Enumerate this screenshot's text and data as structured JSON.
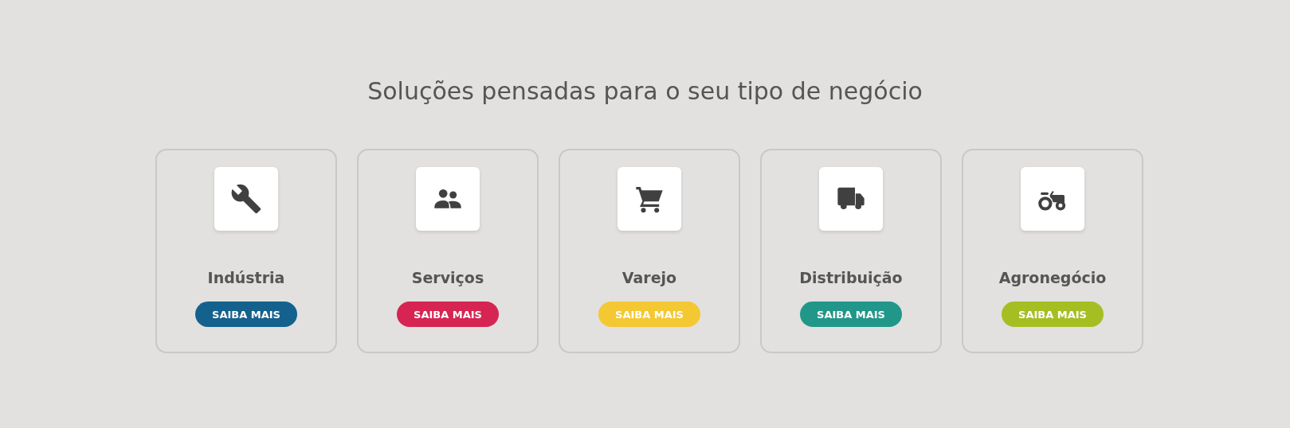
{
  "heading": "Soluções pensadas para o seu tipo de negócio",
  "cards": [
    {
      "kind": "wrench",
      "label": "Indústria",
      "button": "SAIBA MAIS",
      "color": "#14618e"
    },
    {
      "kind": "people",
      "label": "Serviços",
      "button": "SAIBA MAIS",
      "color": "#d62453"
    },
    {
      "kind": "cart",
      "label": "Varejo",
      "button": "SAIBA MAIS",
      "color": "#f4c832"
    },
    {
      "kind": "truck",
      "label": "Distribuição",
      "button": "SAIBA MAIS",
      "color": "#21978a"
    },
    {
      "kind": "tractor",
      "label": "Agronegócio",
      "button": "SAIBA MAIS",
      "color": "#a5bf22"
    }
  ]
}
